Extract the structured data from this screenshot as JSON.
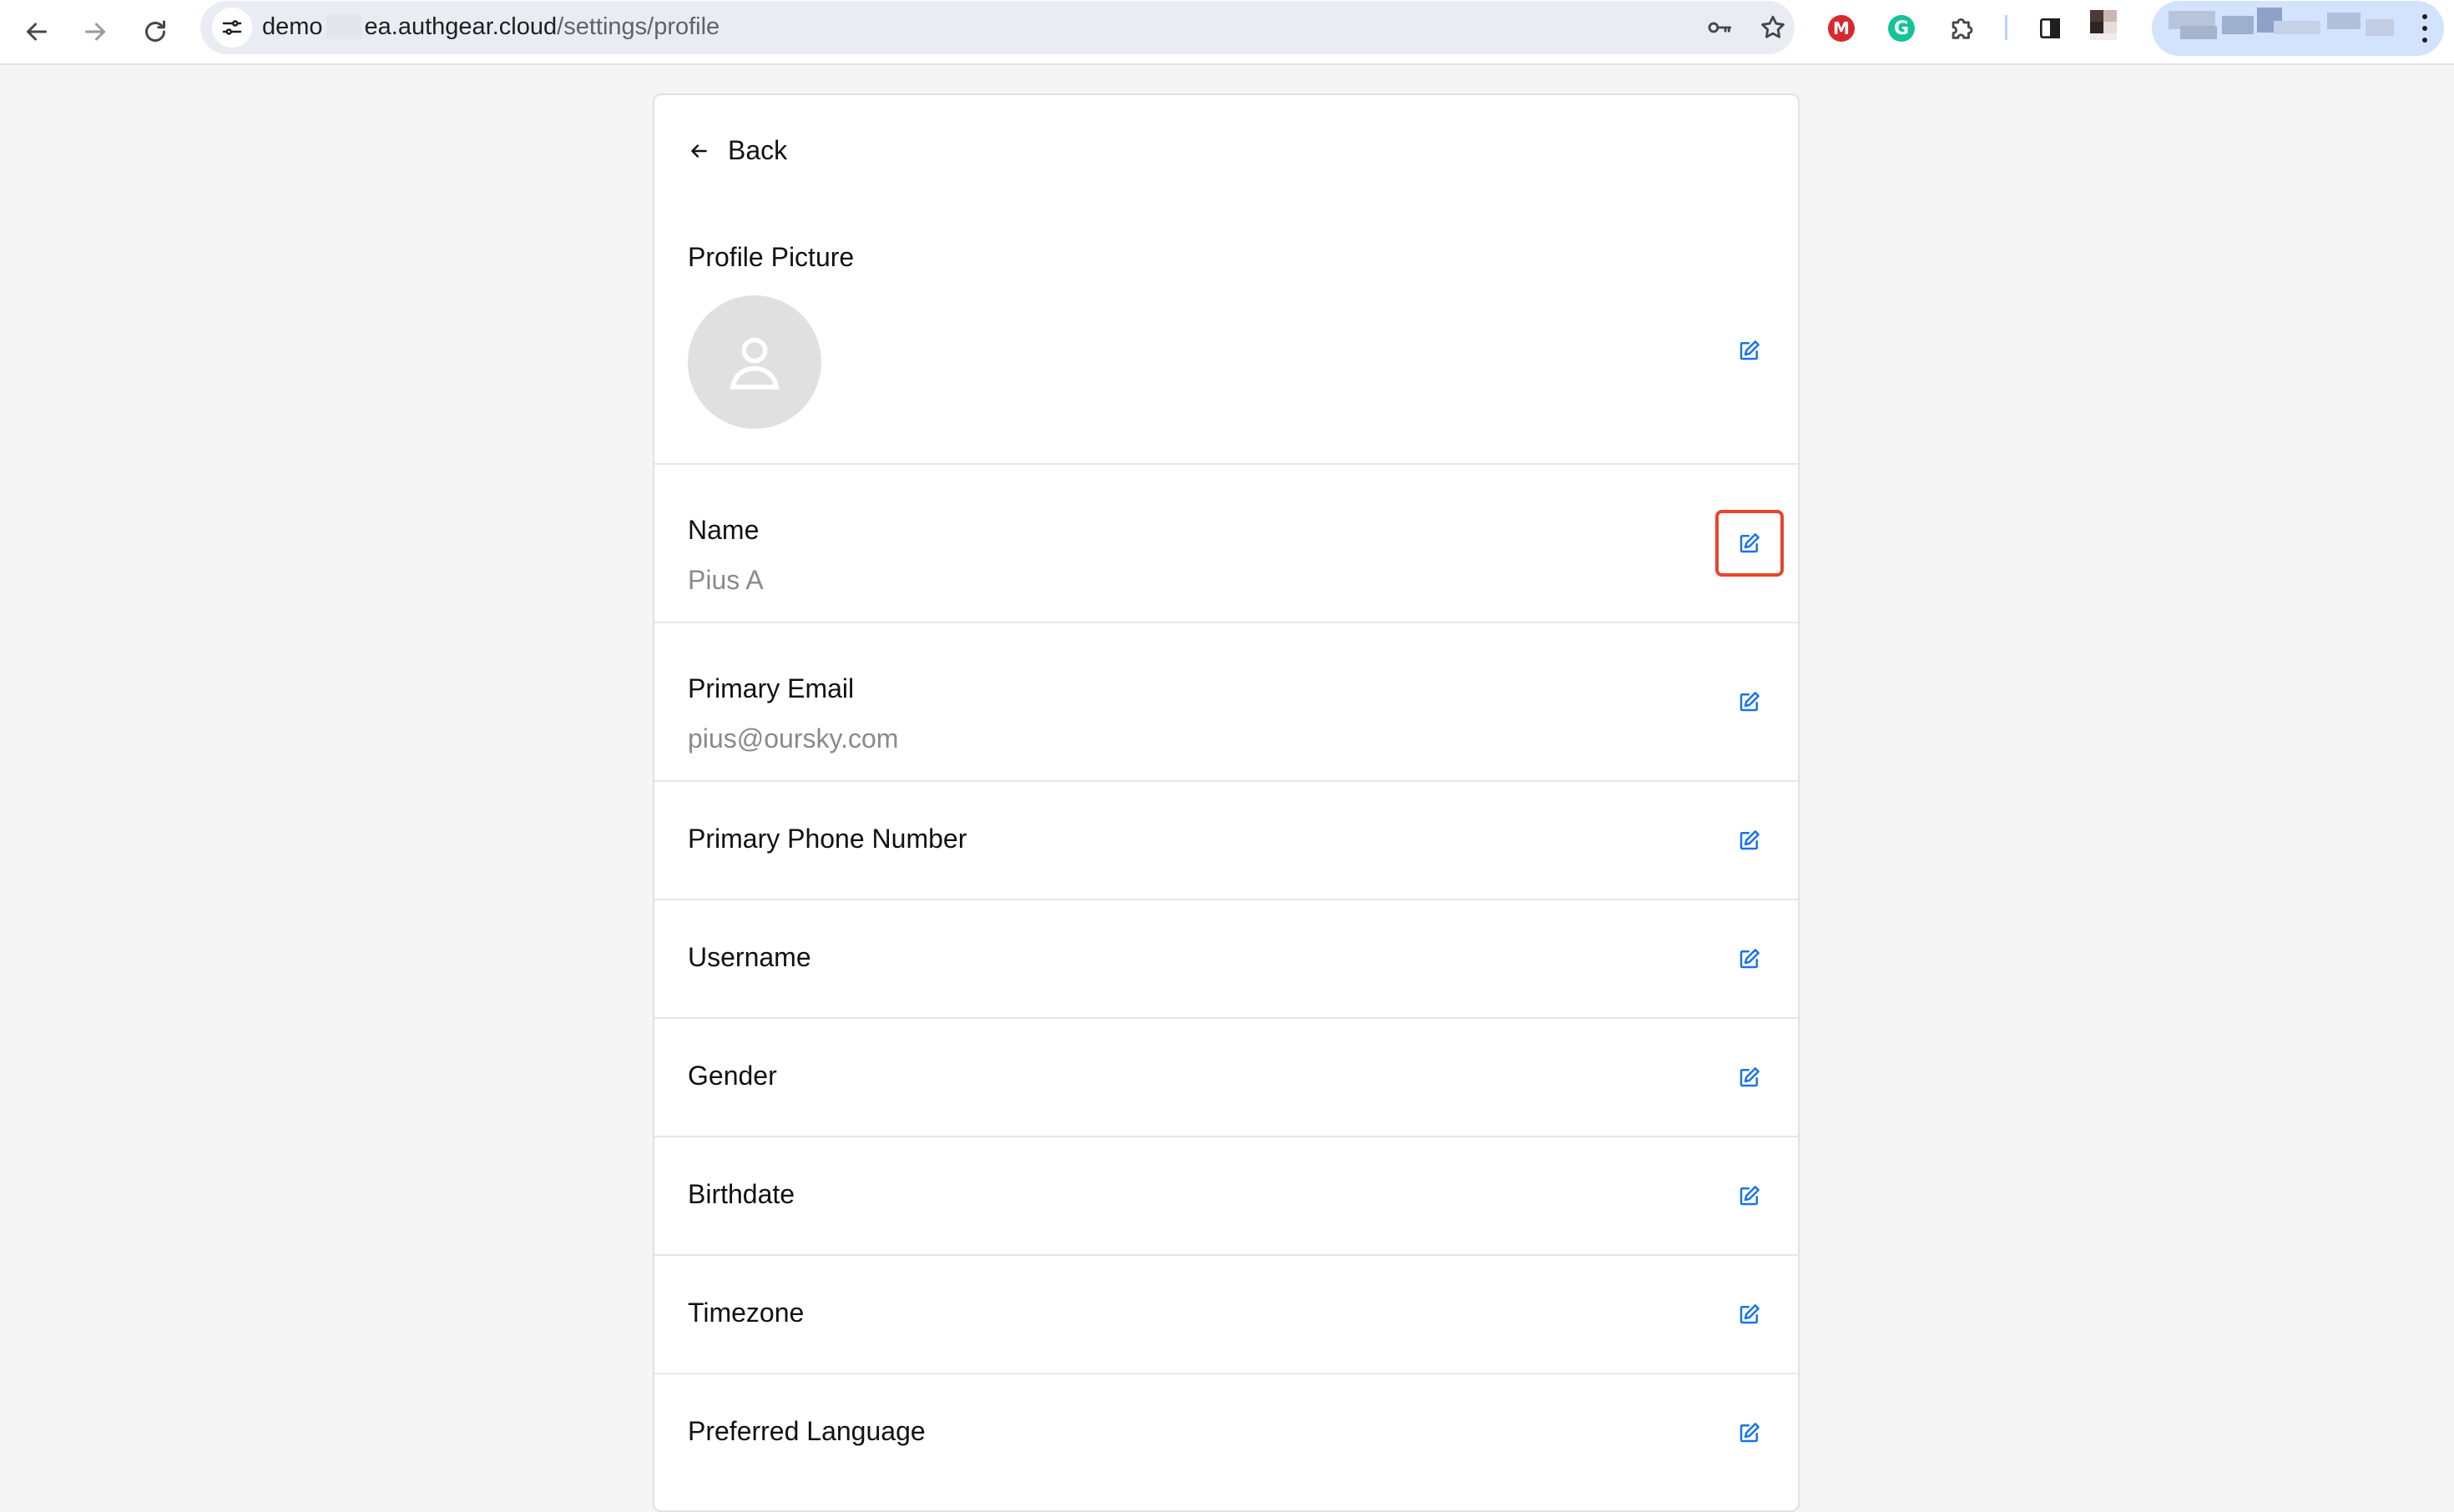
{
  "browser": {
    "url_host_prefix": "demo",
    "url_host_suffix": "ea.authgear.cloud",
    "url_path": "/settings/profile",
    "icons": {
      "back": "back-arrow-icon",
      "forward": "forward-arrow-icon",
      "reload": "reload-icon",
      "site_settings": "site-settings-icon",
      "password": "key-icon",
      "bookmark": "star-icon",
      "extensions": "puzzle-icon",
      "side_panel": "side-panel-icon",
      "menu": "kebab-menu-icon"
    },
    "extensions": [
      {
        "name": "mega-extension",
        "glyph": "M",
        "color": "#d9272e"
      },
      {
        "name": "grammarly-extension",
        "glyph": "G",
        "color": "#15c39a"
      }
    ]
  },
  "page": {
    "back_label": "Back",
    "accent_color": "#1a73e8",
    "highlight_color": "#e8442e",
    "profile_picture": {
      "label": "Profile Picture",
      "icon": "user-avatar-icon"
    },
    "fields": [
      {
        "label": "Name",
        "value": "Pius A",
        "highlighted": true
      },
      {
        "label": "Primary Email",
        "value": "pius@oursky.com"
      },
      {
        "label": "Primary Phone Number",
        "value": ""
      },
      {
        "label": "Username",
        "value": ""
      },
      {
        "label": "Gender",
        "value": ""
      },
      {
        "label": "Birthdate",
        "value": ""
      },
      {
        "label": "Timezone",
        "value": ""
      },
      {
        "label": "Preferred Language",
        "value": ""
      }
    ]
  }
}
